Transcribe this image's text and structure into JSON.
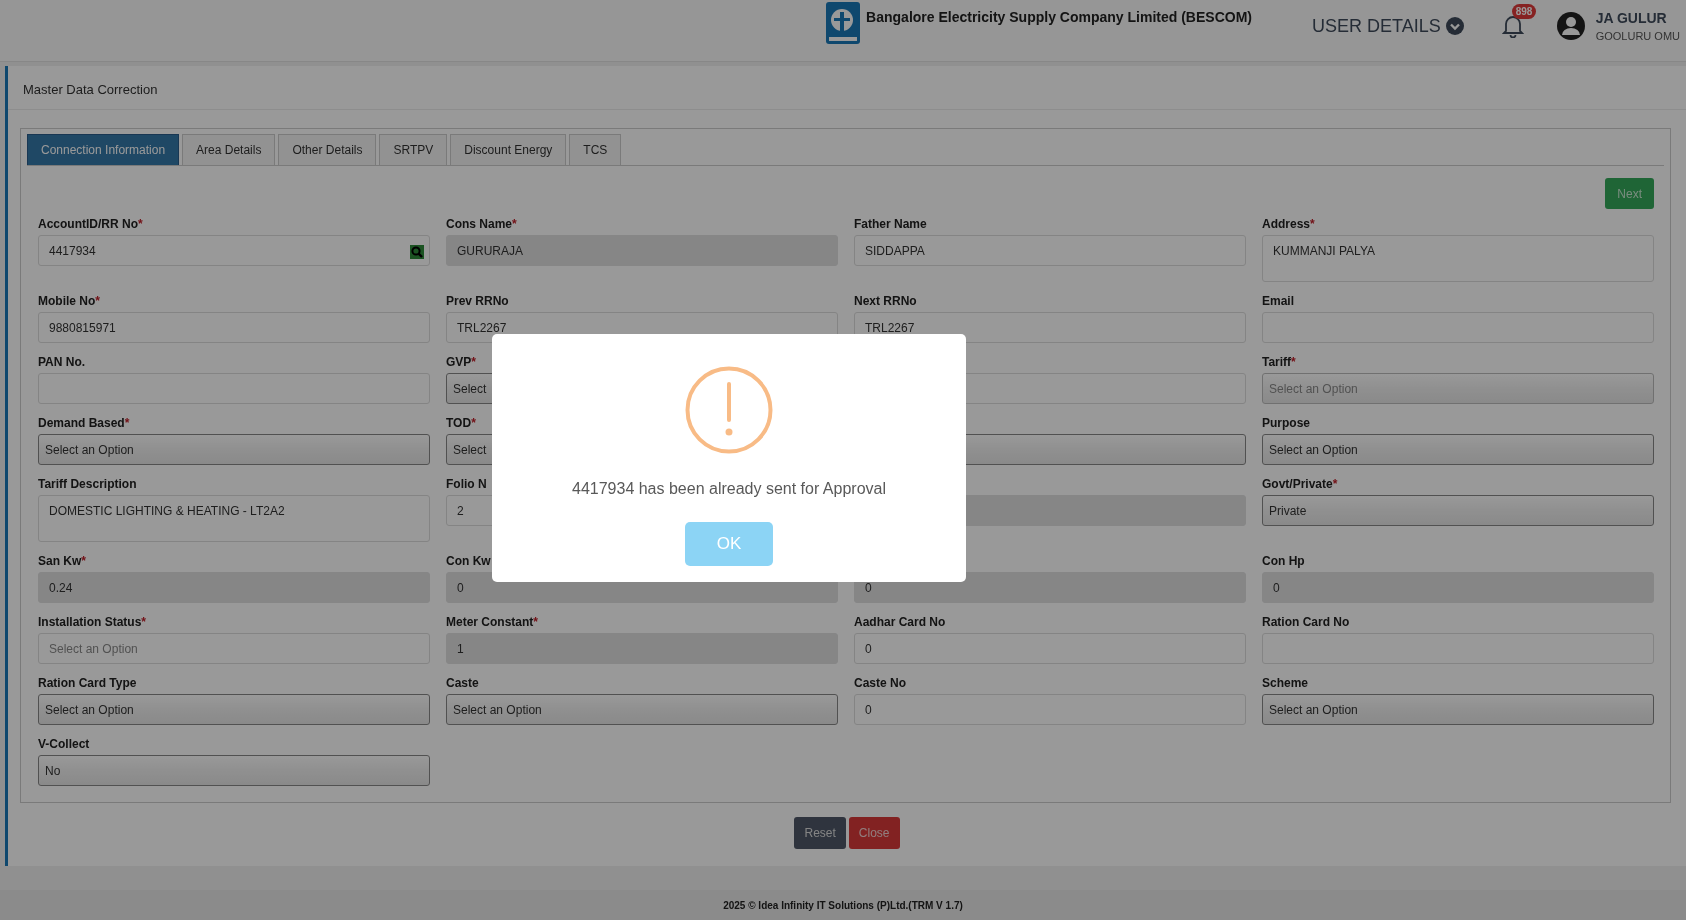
{
  "header": {
    "company": "Bangalore Electricity Supply Company Limited (BESCOM)",
    "user_details": "USER DETAILS",
    "notifications": "898",
    "user_name": "JA GULUR",
    "user_location": "GOOLURU OMU"
  },
  "page_title": "Master Data Correction",
  "tabs": [
    {
      "label": "Connection Information",
      "selected": true
    },
    {
      "label": "Area Details",
      "selected": false
    },
    {
      "label": "Other Details",
      "selected": false
    },
    {
      "label": "SRTPV",
      "selected": false
    },
    {
      "label": "Discount Energy",
      "selected": false
    },
    {
      "label": "TCS",
      "selected": false
    }
  ],
  "next_button": "Next",
  "fields": [
    {
      "label": "AccountID/RR No",
      "mark": "*",
      "kind": "search",
      "value": "4417934"
    },
    {
      "label": "Cons Name",
      "mark": "*",
      "kind": "readonly",
      "value": "GURURAJA"
    },
    {
      "label": "Father Name",
      "kind": "text",
      "value": "SIDDAPPA"
    },
    {
      "label": "Address",
      "mark": "*",
      "kind": "textarea",
      "value": "KUMMANJI PALYA"
    },
    {
      "label": "Mobile No",
      "mark": "*",
      "kind": "text",
      "value": "9880815971"
    },
    {
      "label": "Prev RRNo",
      "kind": "text",
      "value": "TRL2267"
    },
    {
      "label": "Next RRNo",
      "kind": "text",
      "value": "TRL2267"
    },
    {
      "label": "Email",
      "kind": "text"
    },
    {
      "label": "PAN No.",
      "kind": "text"
    },
    {
      "label": "GVP",
      "mark": "*",
      "kind": "select",
      "value": "Select"
    },
    {
      "kind": "text"
    },
    {
      "label": "Tariff",
      "mark": "*",
      "kind": "select",
      "placeholder": "Select an Option"
    },
    {
      "label": "Demand Based",
      "mark": "*",
      "kind": "select",
      "value": "Select an Option"
    },
    {
      "label": "TOD",
      "mark": "*",
      "kind": "select",
      "value": "Select"
    },
    {
      "kind": "select"
    },
    {
      "label": "Purpose",
      "kind": "select",
      "value": "Select an Option"
    },
    {
      "label": "Tariff Description",
      "kind": "textarea",
      "value": "DOMESTIC LIGHTING & HEATING - LT2A2"
    },
    {
      "label": "Folio N",
      "kind": "text",
      "value": "2"
    },
    {
      "kind": "readonly"
    },
    {
      "label": "Govt/Private",
      "mark": "*",
      "kind": "select",
      "value": "Private"
    },
    {
      "label": "San Kw",
      "mark": "*",
      "kind": "readonly",
      "value": "0.24"
    },
    {
      "label": "Con Kw",
      "kind": "readonly",
      "value": "0"
    },
    {
      "kind": "readonly",
      "value": "0"
    },
    {
      "label": "Con Hp",
      "kind": "readonly",
      "value": "0"
    },
    {
      "label": "Installation Status",
      "mark": "*",
      "kind": "text",
      "placeholder": "Select an Option"
    },
    {
      "label": "Meter Constant",
      "mark": "*",
      "kind": "readonly",
      "value": "1"
    },
    {
      "label": "Aadhar Card No",
      "kind": "text",
      "value": "0"
    },
    {
      "label": "Ration Card No",
      "kind": "text"
    },
    {
      "label": "Ration Card Type",
      "kind": "select",
      "value": "Select an Option"
    },
    {
      "label": "Caste",
      "kind": "select",
      "value": "Select an Option"
    },
    {
      "label": "Caste No",
      "kind": "text",
      "value": "0"
    },
    {
      "label": "Scheme",
      "kind": "select",
      "value": "Select an Option"
    },
    {
      "label": "V-Collect",
      "kind": "select",
      "value": "No"
    }
  ],
  "buttons": [
    {
      "label": "Reset",
      "kind": "secondary"
    },
    {
      "label": "Close",
      "kind": "danger"
    }
  ],
  "footer": "2025 © Idea Infinity IT Solutions (P)Ltd.(TRM V 1.7)",
  "dialog": {
    "message": "4417934 has been already sent for Approval",
    "button": "OK"
  }
}
